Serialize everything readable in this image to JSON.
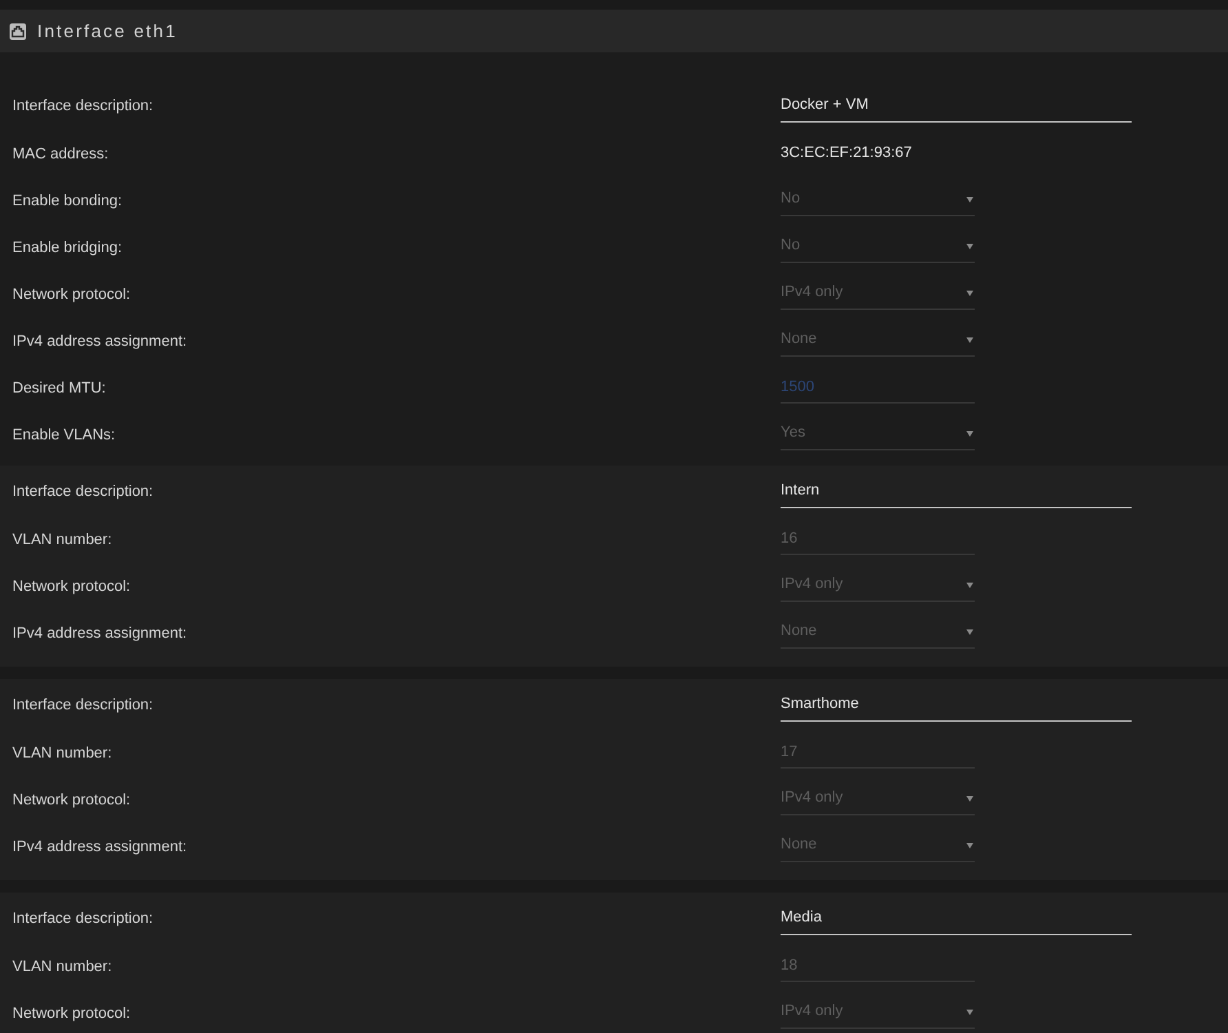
{
  "panel": {
    "title": "Interface eth1"
  },
  "interface_fields": [
    {
      "label": "Interface description:",
      "kind": "text",
      "value": "Docker + VM",
      "disabled": false
    },
    {
      "label": "MAC address:",
      "kind": "static",
      "value": "3C:EC:EF:21:93:67",
      "disabled": false
    },
    {
      "label": "Enable bonding:",
      "kind": "select",
      "value": "No",
      "disabled": true
    },
    {
      "label": "Enable bridging:",
      "kind": "select",
      "value": "No",
      "disabled": true
    },
    {
      "label": "Network protocol:",
      "kind": "select",
      "value": "IPv4 only",
      "disabled": true
    },
    {
      "label": "IPv4 address assignment:",
      "kind": "select",
      "value": "None",
      "disabled": true
    },
    {
      "label": "Desired MTU:",
      "kind": "number",
      "placeholder": "1500",
      "disabled": true
    },
    {
      "label": "Enable VLANs:",
      "kind": "select",
      "value": "Yes",
      "disabled": true
    }
  ],
  "vlans": [
    {
      "fields": [
        {
          "label": "Interface description:",
          "kind": "text",
          "value": "Intern",
          "disabled": false
        },
        {
          "label": "VLAN number:",
          "kind": "number",
          "value": "16",
          "disabled": true
        },
        {
          "label": "Network protocol:",
          "kind": "select",
          "value": "IPv4 only",
          "disabled": true
        },
        {
          "label": "IPv4 address assignment:",
          "kind": "select",
          "value": "None",
          "disabled": true
        }
      ]
    },
    {
      "fields": [
        {
          "label": "Interface description:",
          "kind": "text",
          "value": "Smarthome",
          "disabled": false
        },
        {
          "label": "VLAN number:",
          "kind": "number",
          "value": "17",
          "disabled": true
        },
        {
          "label": "Network protocol:",
          "kind": "select",
          "value": "IPv4 only",
          "disabled": true
        },
        {
          "label": "IPv4 address assignment:",
          "kind": "select",
          "value": "None",
          "disabled": true
        }
      ]
    },
    {
      "fields": [
        {
          "label": "Interface description:",
          "kind": "text",
          "value": "Media",
          "disabled": false
        },
        {
          "label": "VLAN number:",
          "kind": "number",
          "value": "18",
          "disabled": true
        },
        {
          "label": "Network protocol:",
          "kind": "select",
          "value": "IPv4 only",
          "disabled": true
        }
      ]
    }
  ]
}
